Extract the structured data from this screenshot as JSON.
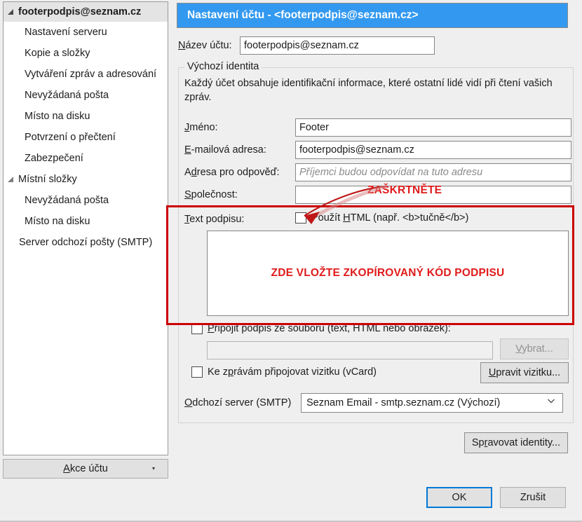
{
  "window": {
    "title": "Nastavení účtu - <footerpodpis@seznam.cz>"
  },
  "sidebar": {
    "items": [
      {
        "label": "footerpodpis@seznam.cz",
        "level": "account",
        "icon": "expand-triangle-icon"
      },
      {
        "label": "Nastavení serveru",
        "level": "child"
      },
      {
        "label": "Kopie a složky",
        "level": "child"
      },
      {
        "label": "Vytváření zpráv a adresování",
        "level": "child"
      },
      {
        "label": "Nevyžádaná pošta",
        "level": "child"
      },
      {
        "label": "Místo na disku",
        "level": "child"
      },
      {
        "label": "Potvrzení o přečtení",
        "level": "child"
      },
      {
        "label": "Zabezpečení",
        "level": "child"
      },
      {
        "label": "Místní složky",
        "level": "group",
        "icon": "expand-triangle-icon"
      },
      {
        "label": "Nevyžádaná pošta",
        "level": "child"
      },
      {
        "label": "Místo na disku",
        "level": "child"
      },
      {
        "label": "Server odchozí pošty (SMTP)",
        "level": "child-deep"
      }
    ],
    "account_actions_button": {
      "label_prefix": "A",
      "label_rest": "kce účtu",
      "caret": "▾"
    }
  },
  "form": {
    "account_name": {
      "label_prefix": "N",
      "label_rest": "ázev účtu:",
      "value": "footerpodpis@seznam.cz"
    },
    "identity_group": {
      "title": "Výchozí identita",
      "description": "Každý účet obsahuje identifikační informace, které ostatní lidé vidí při čtení vašich zpráv."
    },
    "name_field": {
      "label_prefix": "J",
      "label_rest": "méno:",
      "value": "Footer",
      "placeholder": ""
    },
    "email_field": {
      "label_prefix": "E",
      "label_rest": "-mailová adresa:",
      "value": "footerpodpis@seznam.cz",
      "placeholder": ""
    },
    "reply_to_field": {
      "label_prefix": "A",
      "label_mid": "d",
      "label_rest": "resa pro odpověď:",
      "value": "",
      "placeholder": "Příjemci budou odpovídat na tuto adresu"
    },
    "company_field": {
      "label_prefix": "S",
      "label_rest": "polečnost:",
      "value": "",
      "placeholder": ""
    },
    "signature": {
      "label_prefix": "T",
      "label_rest": "ext podpisu:",
      "use_html_label_a": "Použít ",
      "use_html_label_key": "H",
      "use_html_label_b": "TML (např. <b>tučně</b>)",
      "use_html_checked": false,
      "textarea_value": "",
      "textarea_placeholder": ""
    },
    "attach_from_file": {
      "label_prefix": "P",
      "label_mid": "ř",
      "label_rest": "ipojit podpis ze souboru (text, HTML nebo obrázek):",
      "checked": false,
      "path_value": "",
      "path_placeholder": "",
      "choose_button_prefix": "V",
      "choose_button_rest": "ybrat...",
      "choose_button_disabled": true
    },
    "vcard": {
      "label_a": "Ke z",
      "label_key": "p",
      "label_b": "rávám připojovat vizitku (vCard)",
      "checked": false,
      "edit_button_prefix": "U",
      "edit_button_rest": "pravit vizitku..."
    },
    "smtp": {
      "label_prefix": "O",
      "label_rest": "dchozí server (SMTP)",
      "selected_option": "Seznam Email - smtp.seznam.cz (Výchozí)",
      "chevron_icon": "chevron-down-icon"
    },
    "manage_identities_button": {
      "label_a": "Sp",
      "label_key": "r",
      "label_b": "avovat identity..."
    }
  },
  "footer": {
    "ok_label": "OK",
    "cancel_label": "Zrušit"
  },
  "annotations": {
    "check_this": "ZAŠKRTNĚTE",
    "paste_signature": "ZDE VLOŽTE ZKOPÍROVANÝ KÓD PODPISU",
    "highlight_color": "#cc0000",
    "text_color": "#e01b1b"
  },
  "colors": {
    "titlebar_blue": "#3399f0",
    "focus_blue": "#0078d7",
    "window_bg": "#efefef",
    "control_bg": "#e1e1e1"
  }
}
